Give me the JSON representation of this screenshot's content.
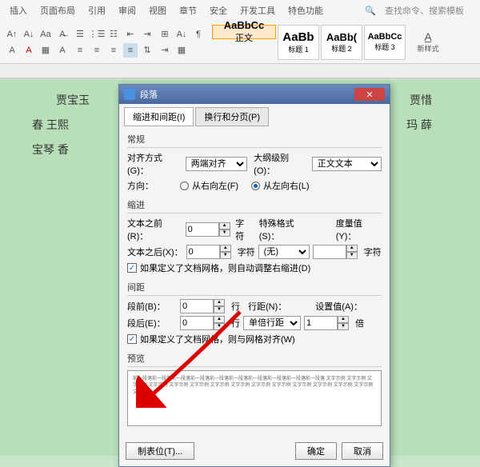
{
  "ribbon": {
    "tabs": [
      "插入",
      "页面布局",
      "引用",
      "审阅",
      "视图",
      "章节",
      "安全",
      "开发工具",
      "特色功能"
    ],
    "search": "查找命令、搜索模板",
    "styles": [
      {
        "preview": "AaBbCc",
        "name": "正文"
      },
      {
        "preview": "AaBb",
        "name": "标题 1"
      },
      {
        "preview": "AaBb(",
        "name": "标题 2"
      },
      {
        "preview": "AaBbCc",
        "name": "标题 3"
      }
    ],
    "newstyle": "新样式"
  },
  "doc": {
    "line1": "贾宝玉",
    "line1b": "贾惜",
    "line2a": "春 王熙",
    "line2b": "玛 薛",
    "line3": "宝琴 香"
  },
  "dlg": {
    "title": "段落",
    "tab1": "缩进和间距(I)",
    "tab2": "换行和分页(P)",
    "sect_general": "常规",
    "align_label": "对齐方式(G)：",
    "align_val": "两端对齐",
    "outline_label": "大纲级别(O)：",
    "outline_val": "正文文本",
    "dir_label": "方向：",
    "dir_rtl": "从右向左(F)",
    "dir_ltr": "从左向右(L)",
    "sect_indent": "缩进",
    "before_text": "文本之前(R)：",
    "after_text": "文本之后(X)：",
    "unit_char": "字符",
    "special_label": "特殊格式(S)：",
    "special_val": "(无)",
    "measure_label": "度量值(Y)：",
    "chk_grid_indent": "如果定义了文档网格，则自动调整右缩进(D)",
    "sect_spacing": "间距",
    "before_para": "段前(B)：",
    "after_para": "段后(E)：",
    "unit_line": "行",
    "linespace_label": "行距(N)：",
    "linespace_val": "单倍行距",
    "setval_label": "设置值(A)：",
    "setval": "1",
    "unit_bei": "倍",
    "chk_grid_align": "如果定义了文档网格，则与网格对齐(W)",
    "sect_preview": "预览",
    "preview_text": "前一段落前一段落前一段落前一段落前一段落前一段落前一段落前一段落前一段落前一段落 文字示例 文字示例 文字示例 文字示例 文字示例 文字示例 文字示例 文字示例 文字示例 文字示例 文字示例 文字示例 文字示例 文字示例 文字示例",
    "btn_tabs": "制表位(T)...",
    "btn_ok": "确定",
    "btn_cancel": "取消",
    "zero": "0"
  }
}
